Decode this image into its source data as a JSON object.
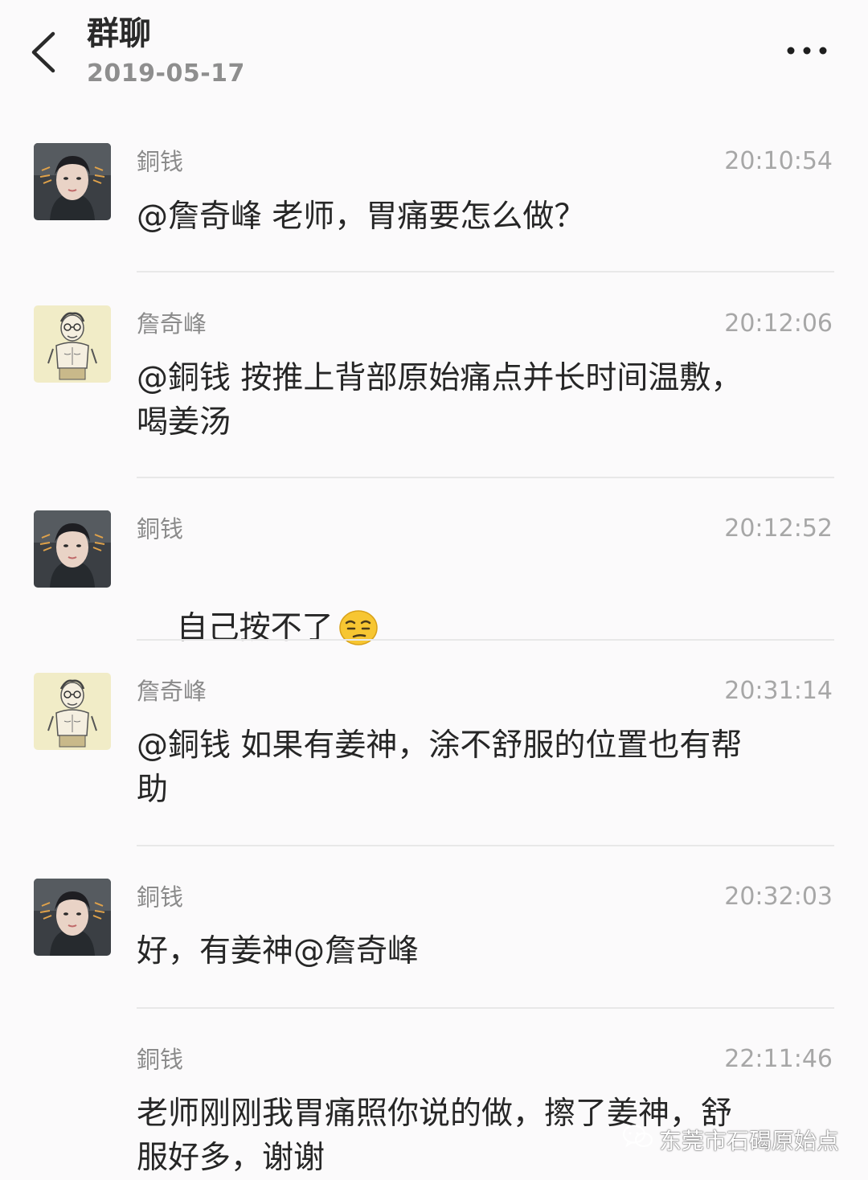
{
  "header": {
    "title": "群聊",
    "date": "2019-05-17",
    "back_icon": "chevron-left-icon",
    "more_icon": "more-dots-icon"
  },
  "messages": [
    {
      "sender": "銅钱",
      "time": "20:10:54",
      "text": "@詹奇峰 老师，胃痛要怎么做？",
      "avatar": "female-avatar"
    },
    {
      "sender": "詹奇峰",
      "time": "20:12:06",
      "text": "@銅钱 按推上背部原始痛点并长时间温敷，\n喝姜汤",
      "avatar": "cartoon-avatar"
    },
    {
      "sender": "銅钱",
      "time": "20:12:52",
      "text": "自己按不了",
      "avatar": "female-avatar",
      "emoji": "sly-face-emoji"
    },
    {
      "sender": "詹奇峰",
      "time": "20:31:14",
      "text": "@銅钱 如果有姜神，涂不舒服的位置也有帮\n助",
      "avatar": "cartoon-avatar"
    },
    {
      "sender": "銅钱",
      "time": "20:32:03",
      "text": "好，有姜神@詹奇峰",
      "avatar": "female-avatar"
    },
    {
      "sender": "銅钱",
      "time": "22:11:46",
      "text": "老师刚刚我胃痛照你说的做，擦了姜神，舒\n服好多，谢谢",
      "avatar": "none"
    }
  ],
  "watermark": {
    "text": "东莞市石碣原始点",
    "icon": "wechat-icon"
  },
  "colors": {
    "background": "#fbfafb",
    "text": "#262626",
    "muted": "#8b8b8b",
    "divider": "#e8e8e8"
  }
}
